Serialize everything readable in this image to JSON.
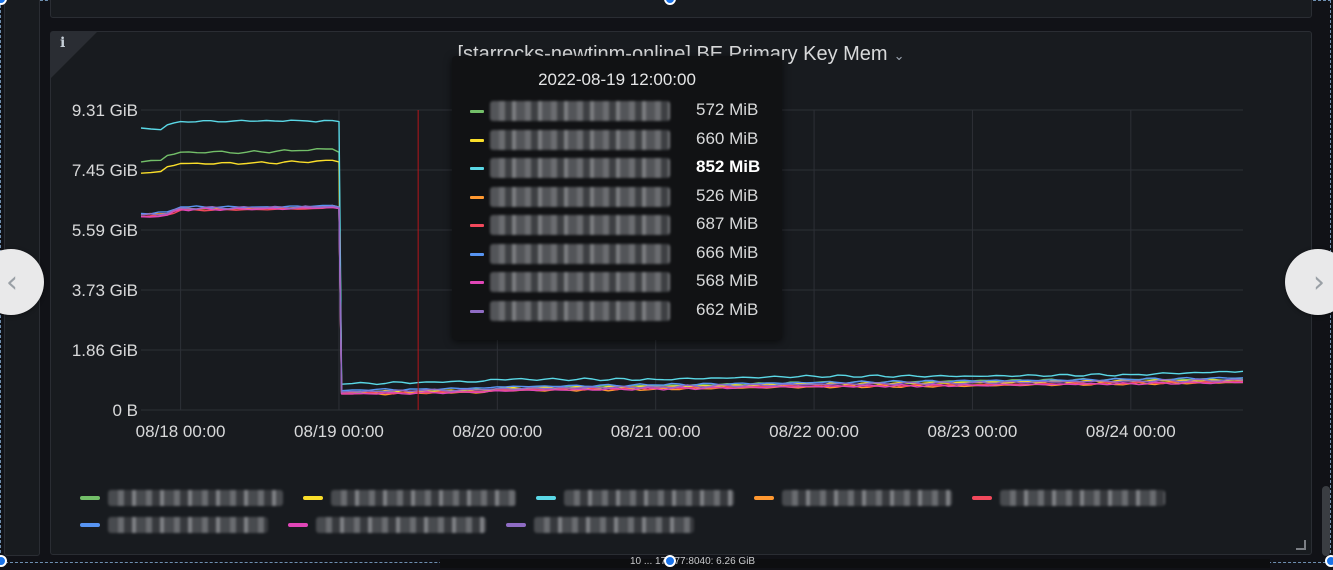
{
  "panel": {
    "title": "[starrocks-newtinm-online] BE Primary Key Mem",
    "title_chevron": "⌄",
    "info_icon": "i"
  },
  "colors": {
    "background": "#111217",
    "panel": "#181b1f",
    "grid": "#2d3036",
    "text": "#d8d9da"
  },
  "chart_data": {
    "type": "line",
    "title": "[starrocks-newtinm-online] BE Primary Key Mem",
    "xlabel": "",
    "ylabel": "",
    "x_tick_labels": [
      "08/18 00:00",
      "08/19 00:00",
      "08/20 00:00",
      "08/21 00:00",
      "08/22 00:00",
      "08/23 00:00",
      "08/24 00:00"
    ],
    "x_ticks": [
      0,
      24,
      48,
      72,
      96,
      120,
      144
    ],
    "xlim": [
      -6,
      161
    ],
    "y_tick_labels": [
      "0 B",
      "1.86 GiB",
      "3.73 GiB",
      "5.59 GiB",
      "7.45 GiB",
      "9.31 GiB"
    ],
    "ylim": [
      0,
      9.31
    ],
    "y_unit": "GiB",
    "grid": true,
    "legend_position": "bottom",
    "cursor_x": 36,
    "series": [
      {
        "color": "#73bf69",
        "values": [
          [
            -6,
            7.7
          ],
          [
            -3,
            7.75
          ],
          [
            -2,
            7.9
          ],
          [
            0,
            8.0
          ],
          [
            10,
            8.0
          ],
          [
            18,
            8.05
          ],
          [
            22,
            8.1
          ],
          [
            23,
            8.1
          ],
          [
            24,
            8.0
          ],
          [
            24.4,
            0.55
          ],
          [
            26,
            0.55
          ],
          [
            36,
            0.57
          ],
          [
            46,
            0.62
          ],
          [
            48,
            0.66
          ],
          [
            72,
            0.75
          ],
          [
            96,
            0.85
          ],
          [
            120,
            0.9
          ],
          [
            144,
            0.95
          ],
          [
            161,
            0.95
          ]
        ]
      },
      {
        "color": "#fade2a",
        "values": [
          [
            -6,
            7.35
          ],
          [
            -3,
            7.4
          ],
          [
            -2,
            7.55
          ],
          [
            0,
            7.65
          ],
          [
            10,
            7.65
          ],
          [
            18,
            7.7
          ],
          [
            22,
            7.75
          ],
          [
            23,
            7.75
          ],
          [
            24,
            7.7
          ],
          [
            24.4,
            0.55
          ],
          [
            26,
            0.56
          ],
          [
            36,
            0.58
          ],
          [
            46,
            0.62
          ],
          [
            48,
            0.66
          ],
          [
            72,
            0.72
          ],
          [
            96,
            0.8
          ],
          [
            120,
            0.85
          ],
          [
            144,
            0.9
          ],
          [
            161,
            0.92
          ]
        ]
      },
      {
        "color": "#5ad8e6",
        "values": [
          [
            -6,
            8.75
          ],
          [
            -3,
            8.7
          ],
          [
            -2,
            8.85
          ],
          [
            0,
            8.95
          ],
          [
            8,
            8.97
          ],
          [
            18,
            8.98
          ],
          [
            23,
            8.98
          ],
          [
            24,
            8.95
          ],
          [
            24.4,
            0.8
          ],
          [
            26,
            0.82
          ],
          [
            36,
            0.85
          ],
          [
            46,
            0.9
          ],
          [
            48,
            0.95
          ],
          [
            72,
            0.95
          ],
          [
            96,
            1.05
          ],
          [
            120,
            1.05
          ],
          [
            144,
            1.1
          ],
          [
            161,
            1.2
          ]
        ]
      },
      {
        "color": "#ff9830",
        "values": [
          [
            -6,
            6.05
          ],
          [
            -2,
            6.1
          ],
          [
            0,
            6.25
          ],
          [
            12,
            6.25
          ],
          [
            20,
            6.3
          ],
          [
            23,
            6.35
          ],
          [
            24,
            6.3
          ],
          [
            24.4,
            0.5
          ],
          [
            26,
            0.5
          ],
          [
            36,
            0.52
          ],
          [
            46,
            0.55
          ],
          [
            48,
            0.6
          ],
          [
            72,
            0.65
          ],
          [
            96,
            0.72
          ],
          [
            120,
            0.75
          ],
          [
            144,
            0.82
          ],
          [
            161,
            0.85
          ]
        ]
      },
      {
        "color": "#f2495c",
        "values": [
          [
            -6,
            6.0
          ],
          [
            -2,
            6.05
          ],
          [
            0,
            6.2
          ],
          [
            12,
            6.22
          ],
          [
            20,
            6.25
          ],
          [
            23,
            6.3
          ],
          [
            24,
            6.25
          ],
          [
            24.4,
            0.52
          ],
          [
            26,
            0.52
          ],
          [
            36,
            0.55
          ],
          [
            46,
            0.57
          ],
          [
            48,
            0.62
          ],
          [
            72,
            0.68
          ],
          [
            96,
            0.75
          ],
          [
            120,
            0.78
          ],
          [
            144,
            0.84
          ],
          [
            161,
            0.88
          ]
        ]
      },
      {
        "color": "#5794f2",
        "values": [
          [
            -6,
            6.1
          ],
          [
            -2,
            6.15
          ],
          [
            0,
            6.3
          ],
          [
            12,
            6.3
          ],
          [
            20,
            6.32
          ],
          [
            23,
            6.35
          ],
          [
            24,
            6.3
          ],
          [
            24.4,
            0.6
          ],
          [
            26,
            0.62
          ],
          [
            36,
            0.65
          ],
          [
            46,
            0.68
          ],
          [
            48,
            0.72
          ],
          [
            72,
            0.78
          ],
          [
            96,
            0.85
          ],
          [
            120,
            0.9
          ],
          [
            144,
            0.95
          ],
          [
            161,
            1.0
          ]
        ]
      },
      {
        "color": "#e046b7",
        "values": [
          [
            -6,
            6.0
          ],
          [
            -2,
            6.05
          ],
          [
            0,
            6.22
          ],
          [
            12,
            6.24
          ],
          [
            20,
            6.26
          ],
          [
            23,
            6.28
          ],
          [
            24,
            6.25
          ],
          [
            24.4,
            0.5
          ],
          [
            26,
            0.5
          ],
          [
            36,
            0.53
          ],
          [
            46,
            0.56
          ],
          [
            48,
            0.6
          ],
          [
            72,
            0.66
          ],
          [
            96,
            0.73
          ],
          [
            120,
            0.77
          ],
          [
            144,
            0.82
          ],
          [
            161,
            0.86
          ]
        ]
      },
      {
        "color": "#8f6cc4",
        "values": [
          [
            -6,
            6.05
          ],
          [
            -2,
            6.1
          ],
          [
            0,
            6.27
          ],
          [
            12,
            6.28
          ],
          [
            20,
            6.3
          ],
          [
            23,
            6.32
          ],
          [
            24,
            6.28
          ],
          [
            24.4,
            0.56
          ],
          [
            26,
            0.57
          ],
          [
            36,
            0.6
          ],
          [
            46,
            0.63
          ],
          [
            48,
            0.66
          ],
          [
            72,
            0.72
          ],
          [
            96,
            0.8
          ],
          [
            120,
            0.85
          ],
          [
            144,
            0.9
          ],
          [
            161,
            0.93
          ]
        ]
      }
    ]
  },
  "tooltip": {
    "time": "2022-08-19 12:00:00",
    "rows": [
      {
        "color": "#73bf69",
        "value": "572 MiB",
        "bold": false
      },
      {
        "color": "#fade2a",
        "value": "660 MiB",
        "bold": false
      },
      {
        "color": "#5ad8e6",
        "value": "852 MiB",
        "bold": true
      },
      {
        "color": "#ff9830",
        "value": "526 MiB",
        "bold": false
      },
      {
        "color": "#f2495c",
        "value": "687 MiB",
        "bold": false
      },
      {
        "color": "#5794f2",
        "value": "666 MiB",
        "bold": false
      },
      {
        "color": "#e046b7",
        "value": "568 MiB",
        "bold": false
      },
      {
        "color": "#8f6cc4",
        "value": "662 MiB",
        "bold": false
      }
    ]
  },
  "legend": {
    "row1": [
      {
        "color": "#73bf69"
      },
      {
        "color": "#fade2a"
      },
      {
        "color": "#5ad8e6"
      },
      {
        "color": "#ff9830"
      },
      {
        "color": "#f2495c"
      }
    ],
    "row2": [
      {
        "color": "#5794f2"
      },
      {
        "color": "#e046b7"
      },
      {
        "color": "#8f6cc4"
      }
    ]
  },
  "nav": {
    "prev_glyph": "‹",
    "next_glyph": "›"
  },
  "bottom_strip": {
    "text": "10 ... 177.77:8040:   6.26 GiB"
  }
}
